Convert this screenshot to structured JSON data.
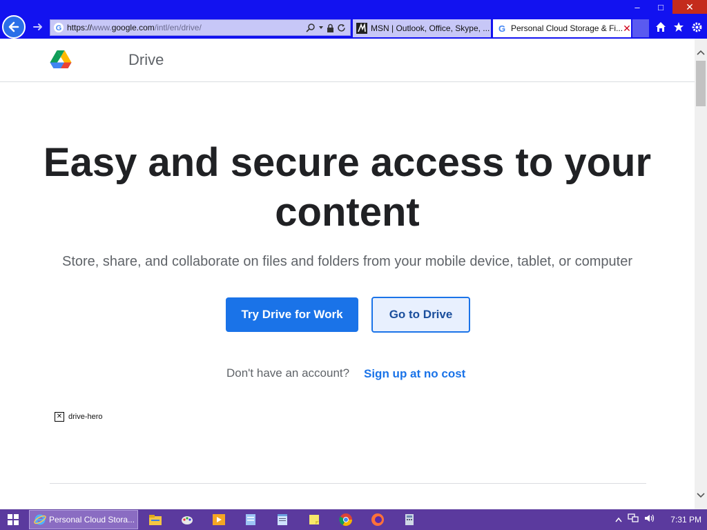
{
  "browser": {
    "url_prefix": "https://",
    "url_domain_muted": "www.",
    "url_domain": "google.com",
    "url_path": "/intl/en/drive/",
    "tabs": [
      {
        "title": "MSN | Outlook, Office, Skype, ...",
        "active": false
      },
      {
        "title": "Personal Cloud Storage & Fi...",
        "active": true
      }
    ],
    "window_buttons": {
      "minimize": "–",
      "maximize": "□",
      "close": "✕"
    }
  },
  "page": {
    "brand": "Drive",
    "hero_title": "Easy and secure access to your content",
    "hero_subtitle": "Store, share, and collaborate on files and folders from your mobile device, tablet, or computer",
    "primary_button": "Try Drive for Work",
    "secondary_button": "Go to Drive",
    "no_account_text": "Don't have an account?",
    "signup_link": "Sign up at no cost",
    "broken_image_alt": "drive-hero"
  },
  "taskbar": {
    "active_window": "Personal Cloud Stora...",
    "pinned_icons": [
      "file-explorer-icon",
      "paint-icon",
      "media-player-icon",
      "notepad-blue-icon",
      "notepad-icon",
      "sticky-notes-icon",
      "chrome-icon",
      "firefox-icon",
      "calculator-icon"
    ],
    "clock": "7:31 PM"
  },
  "colors": {
    "chrome_bg": "#1212f0",
    "taskbar_bg": "#5b3a9e",
    "primary_blue": "#1a73e8"
  }
}
